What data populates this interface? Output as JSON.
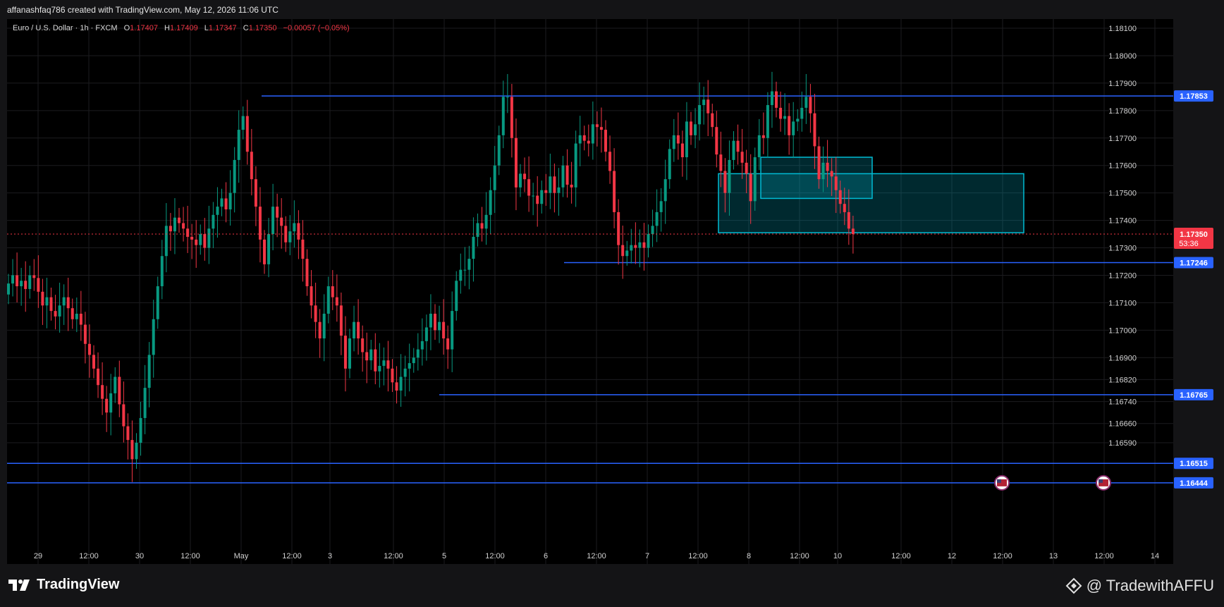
{
  "header": {
    "attribution": "affanashfaq786 created with TradingView.com, May 12, 2026 11:06 UTC"
  },
  "legend": {
    "symbol": "Euro / U.S. Dollar · 1h · FXCM",
    "o_label": "O",
    "o": "1.17407",
    "h_label": "H",
    "h": "1.17409",
    "l_label": "L",
    "l": "1.17347",
    "c_label": "C",
    "c": "1.17350",
    "change": "−0.00057 (−0.05%)"
  },
  "footer": {
    "brand": "TradingView",
    "watermark": "@ TradewithAFFU"
  },
  "colors": {
    "up": "#089981",
    "down": "#f23645",
    "hline": "#2962ff",
    "zone": "#00bcd4",
    "bg": "#000000"
  },
  "chart_data": {
    "type": "candlestick",
    "symbol": "EURUSD",
    "timeframe": "1h",
    "ylim": [
      1.1644,
      1.1812
    ],
    "y_ticks": [
      "1.18100",
      "1.18000",
      "1.17900",
      "1.17800",
      "1.17700",
      "1.17600",
      "1.17500",
      "1.17400",
      "1.17300",
      "1.17200",
      "1.17100",
      "1.17000",
      "1.16900",
      "1.16820",
      "1.16740",
      "1.16660",
      "1.16590"
    ],
    "x_ticks": [
      "29",
      "12:00",
      "30",
      "12:00",
      "May",
      "12:00",
      "3",
      "12:00",
      "5",
      "12:00",
      "6",
      "12:00",
      "7",
      "12:00",
      "8",
      "12:00",
      "10",
      "12:00",
      "12",
      "12:00",
      "13",
      "12:00",
      "14"
    ],
    "horizontal_levels": [
      {
        "price": 1.17853,
        "label": "1.17853"
      },
      {
        "price": 1.17246,
        "label": "1.17246"
      },
      {
        "price": 1.16765,
        "label": "1.16765"
      },
      {
        "price": 1.16515,
        "label": "1.16515"
      },
      {
        "price": 1.16444,
        "label": "1.16444"
      }
    ],
    "current_price": {
      "price": 1.1735,
      "label": "1.17350",
      "countdown": "53:36"
    },
    "zones": [
      {
        "from": "May 7 20:00",
        "to": "May 11 05:00",
        "top": 1.1763,
        "bottom": 1.1748
      },
      {
        "from": "May 7 06:00",
        "to": "May 12 17:00",
        "top": 1.1757,
        "bottom": 1.17355
      }
    ],
    "event_markers": [
      {
        "time": "May 12 12:00",
        "icon": "us-flag-icon"
      },
      {
        "time": "May 13 12:00",
        "icon": "us-flag-icon"
      }
    ],
    "closes": [
      1.1717,
      1.172,
      1.1716,
      1.1718,
      1.1715,
      1.172,
      1.1719,
      1.1714,
      1.1709,
      1.1712,
      1.1707,
      1.1705,
      1.1709,
      1.1712,
      1.1708,
      1.1704,
      1.1706,
      1.1702,
      1.1695,
      1.1691,
      1.1686,
      1.168,
      1.1675,
      1.167,
      1.1677,
      1.1683,
      1.1673,
      1.1665,
      1.166,
      1.1653,
      1.1659,
      1.1668,
      1.1679,
      1.1691,
      1.1704,
      1.1716,
      1.1727,
      1.1738,
      1.1736,
      1.1741,
      1.1739,
      1.1737,
      1.1734,
      1.1733,
      1.1731,
      1.1735,
      1.173,
      1.1737,
      1.1742,
      1.1745,
      1.1748,
      1.1744,
      1.175,
      1.1762,
      1.1773,
      1.1778,
      1.1765,
      1.1755,
      1.1745,
      1.1733,
      1.1724,
      1.1735,
      1.1745,
      1.1741,
      1.1738,
      1.1732,
      1.1736,
      1.1739,
      1.1733,
      1.1726,
      1.1716,
      1.1709,
      1.1703,
      1.1697,
      1.1706,
      1.1716,
      1.1712,
      1.1709,
      1.1698,
      1.1686,
      1.1697,
      1.1703,
      1.1697,
      1.1692,
      1.1689,
      1.1693,
      1.1685,
      1.1687,
      1.1689,
      1.1686,
      1.1681,
      1.1678,
      1.1683,
      1.1686,
      1.1688,
      1.169,
      1.1693,
      1.1696,
      1.1701,
      1.1706,
      1.17,
      1.1703,
      1.1697,
      1.1693,
      1.1707,
      1.1718,
      1.1722,
      1.1722,
      1.1726,
      1.1734,
      1.1739,
      1.1737,
      1.1742,
      1.1751,
      1.176,
      1.1771,
      1.1785,
      1.1785,
      1.177,
      1.1752,
      1.1757,
      1.1755,
      1.1749,
      1.1749,
      1.1746,
      1.1751,
      1.175,
      1.1756,
      1.175,
      1.1752,
      1.176,
      1.1753,
      1.1752,
      1.1768,
      1.1771,
      1.1769,
      1.1768,
      1.1775,
      1.1774,
      1.1773,
      1.1765,
      1.1758,
      1.1743,
      1.1731,
      1.1727,
      1.1729,
      1.1731,
      1.173,
      1.1732,
      1.173,
      1.1735,
      1.1738,
      1.1743,
      1.1747,
      1.1755,
      1.1766,
      1.1771,
      1.1768,
      1.1763,
      1.1776,
      1.1771,
      1.1775,
      1.1782,
      1.1784,
      1.1779,
      1.1774,
      1.1764,
      1.1758,
      1.175,
      1.1762,
      1.1769,
      1.1765,
      1.1761,
      1.1757,
      1.1747,
      1.1763,
      1.1771,
      1.177,
      1.1782,
      1.1787,
      1.1781,
      1.1777,
      1.1778,
      1.1771,
      1.1776,
      1.1777,
      1.1781,
      1.1785,
      1.1779,
      1.1767,
      1.1755,
      1.1761,
      1.1758,
      1.1756,
      1.1751,
      1.1746,
      1.1743,
      1.1737,
      1.1735
    ]
  }
}
